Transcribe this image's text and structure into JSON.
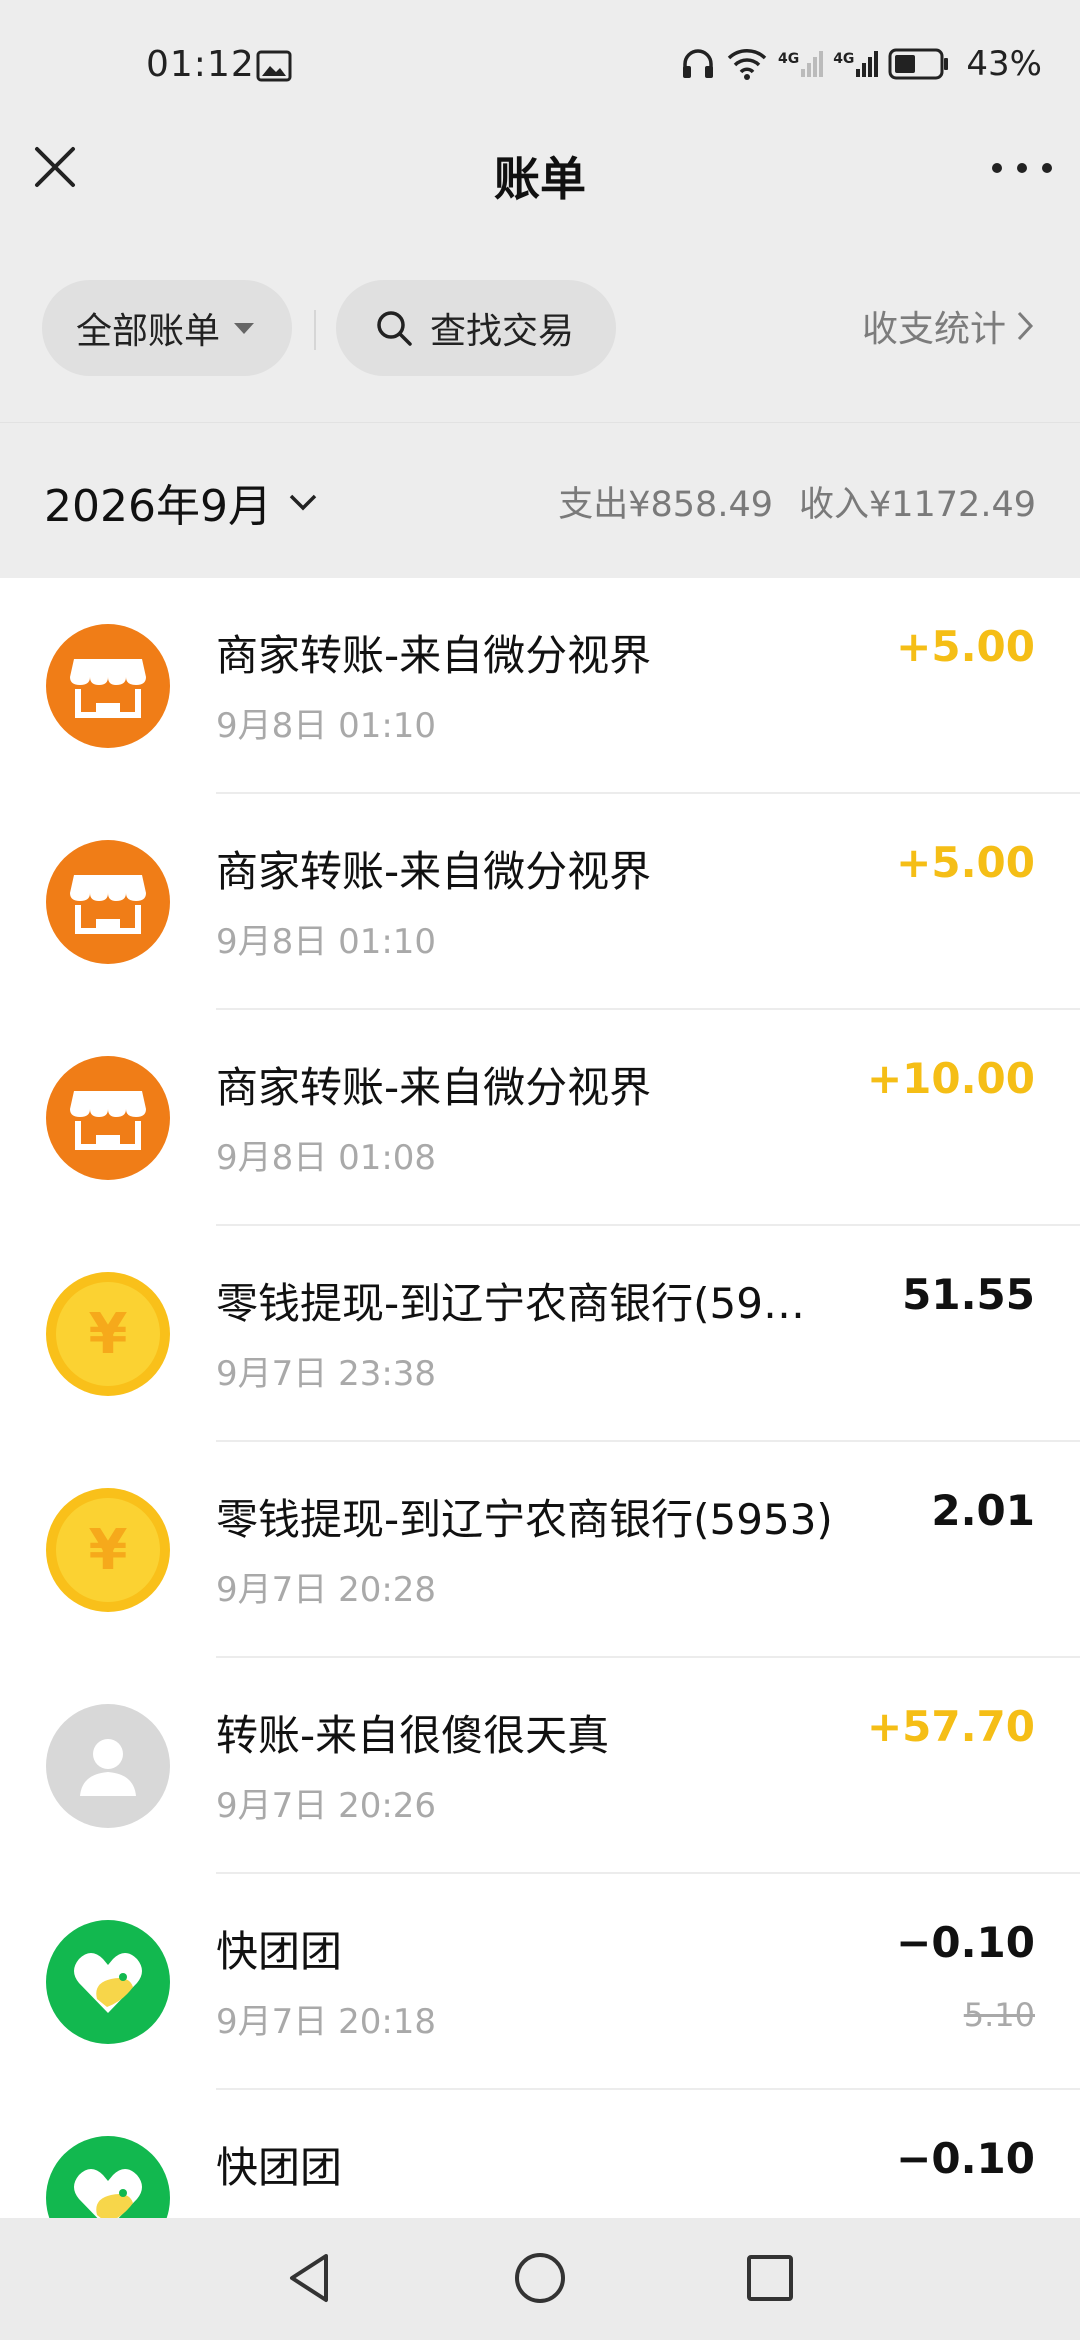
{
  "status": {
    "time": "01:12",
    "battery_pct": "43%",
    "net1": "4G",
    "net2": "4G"
  },
  "header": {
    "title": "账单"
  },
  "filters": {
    "all_bills": "全部账单",
    "search": "查找交易",
    "stats": "收支统计"
  },
  "month": {
    "label": "2026年9月",
    "expense": "支出¥858.49",
    "income": "收入¥1172.49"
  },
  "transactions": [
    {
      "title": "商家转账-来自微分视界",
      "time": "9月8日 01:10",
      "amount": "+5.00",
      "icon": "merchant-store-icon"
    },
    {
      "title": "商家转账-来自微分视界",
      "time": "9月8日 01:10",
      "amount": "+5.00",
      "icon": "merchant-store-icon"
    },
    {
      "title": "商家转账-来自微分视界",
      "time": "9月8日 01:08",
      "amount": "+10.00",
      "icon": "merchant-store-icon"
    },
    {
      "title": "零钱提现-到辽宁农商银行(59…",
      "time": "9月7日 23:38",
      "amount": "51.55",
      "icon": "yuan-coin-icon"
    },
    {
      "title": "零钱提现-到辽宁农商银行(5953)",
      "time": "9月7日 20:28",
      "amount": "2.01",
      "icon": "yuan-coin-icon"
    },
    {
      "title": "转账-来自很傻很天真",
      "time": "9月7日 20:26",
      "amount": "+57.70",
      "icon": "user-avatar-icon"
    },
    {
      "title": "快团团",
      "time": "9月7日 20:18",
      "amount": "−0.10",
      "original": "5.10",
      "icon": "kuaituantuan-logo-icon"
    },
    {
      "title": "快团团",
      "time": "",
      "amount": "−0.10",
      "icon": "kuaituantuan-logo-icon"
    }
  ],
  "colors": {
    "income": "#f5be16",
    "merchant": "#f07d17",
    "coin": "#f9c01a",
    "app": "#12b84f"
  }
}
